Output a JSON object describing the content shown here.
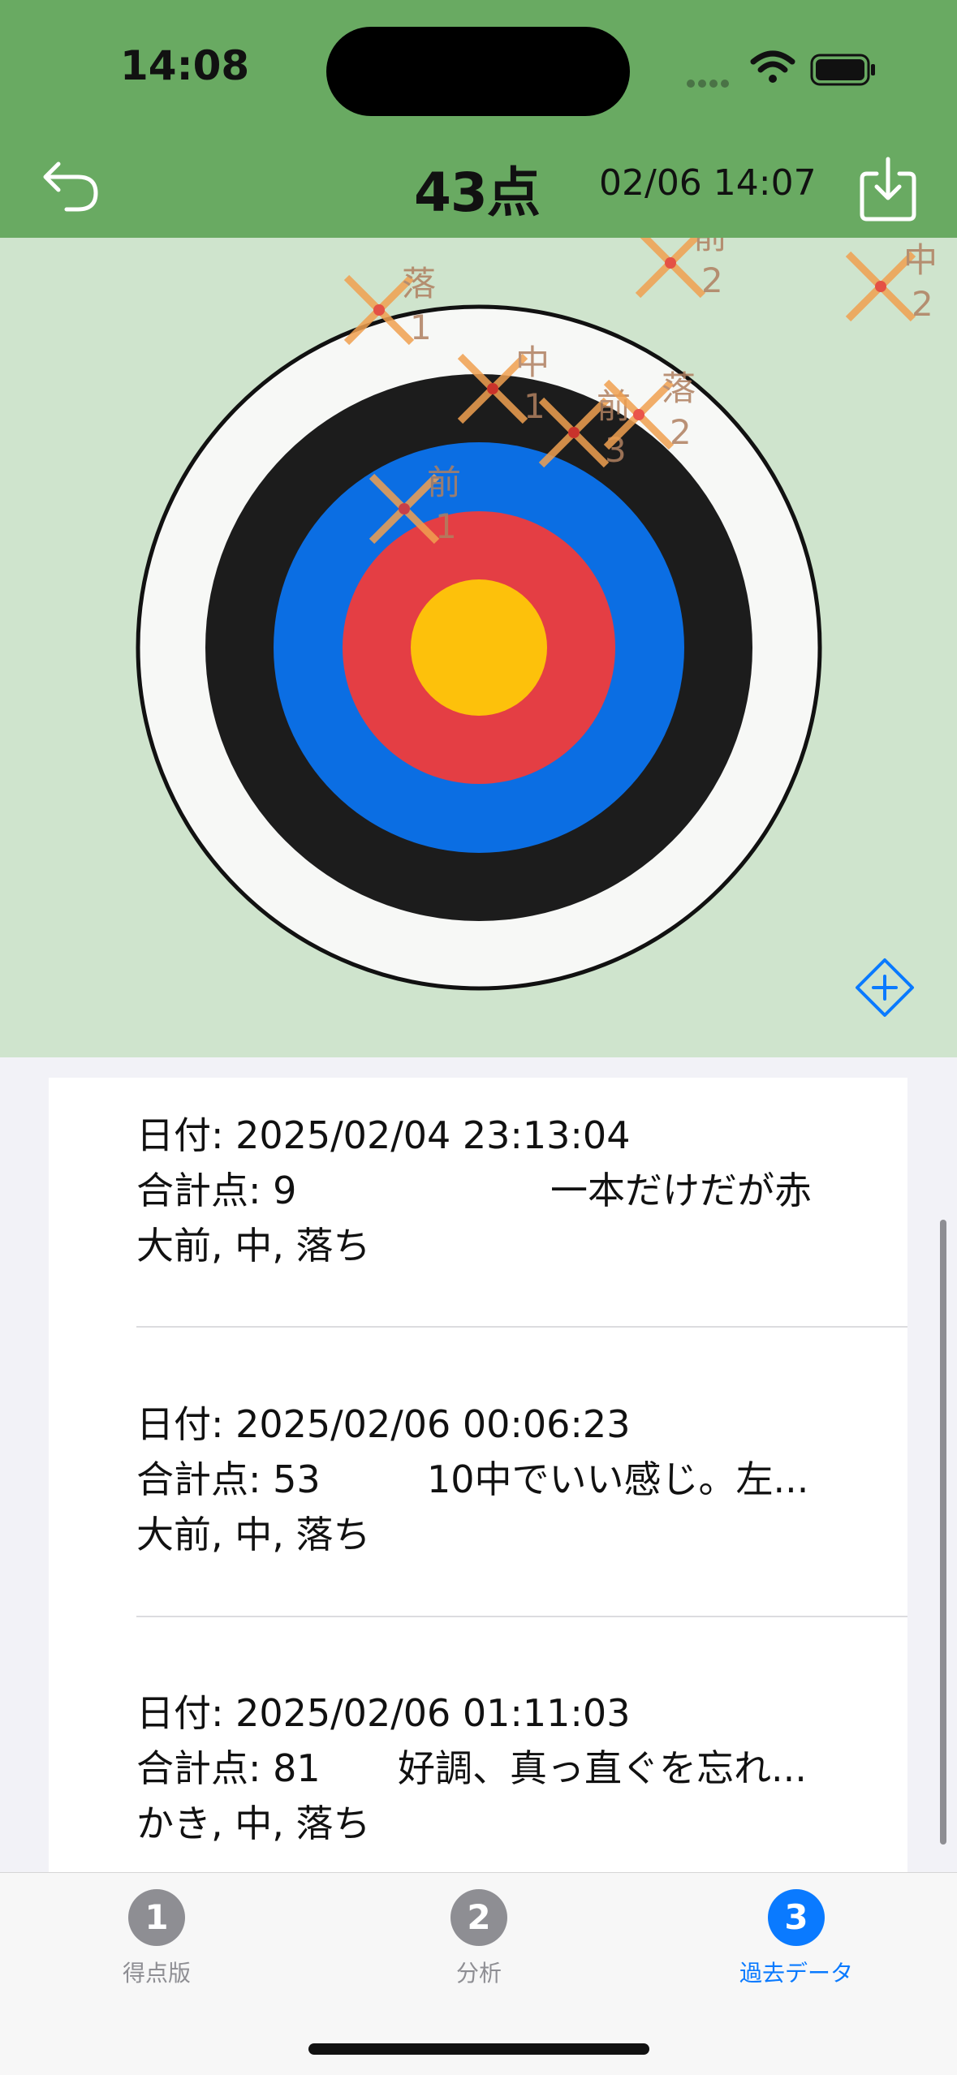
{
  "status": {
    "time": "14:08"
  },
  "nav": {
    "score": "43点",
    "date": "02/06 14:07"
  },
  "arrows": [
    {
      "label": "中",
      "num": "1"
    },
    {
      "label": "前",
      "num": "2"
    },
    {
      "label": "中",
      "num": "2"
    },
    {
      "label": "落",
      "num": "1"
    },
    {
      "label": "前",
      "num": "3"
    },
    {
      "label": "落",
      "num": "2"
    },
    {
      "label": "前",
      "num": "1"
    }
  ],
  "history": [
    {
      "date": "日付: 2025/02/04 23:13:04",
      "total": "合計点: 9",
      "note": "一本だけだが赤",
      "tags": "大前, 中, 落ち"
    },
    {
      "date": "日付: 2025/02/06 00:06:23",
      "total": "合計点: 53",
      "note": "10中でいい感じ。左...",
      "tags": "大前, 中, 落ち"
    },
    {
      "date": "日付: 2025/02/06 01:11:03",
      "total": "合計点: 81",
      "note": "好調、真っ直ぐを忘れ...",
      "tags": "かき, 中, 落ち"
    }
  ],
  "tabs": [
    {
      "num": "1",
      "label": "得点版"
    },
    {
      "num": "2",
      "label": "分析"
    },
    {
      "num": "3",
      "label": "過去データ"
    }
  ],
  "colors": {
    "header": "#69aa62",
    "target_bg": "#cfe4cd",
    "ring_white": "#f7f8f6",
    "ring_black": "#1c1c1c",
    "ring_blue": "#0b6ee3",
    "ring_red": "#e43e44",
    "ring_gold": "#fdc10b",
    "arrow": "#f0a050",
    "accent": "#0a7aff"
  },
  "icons": {
    "back": "undo-arrow-icon",
    "download": "download-tray-icon",
    "add": "plus-diamond-icon"
  }
}
